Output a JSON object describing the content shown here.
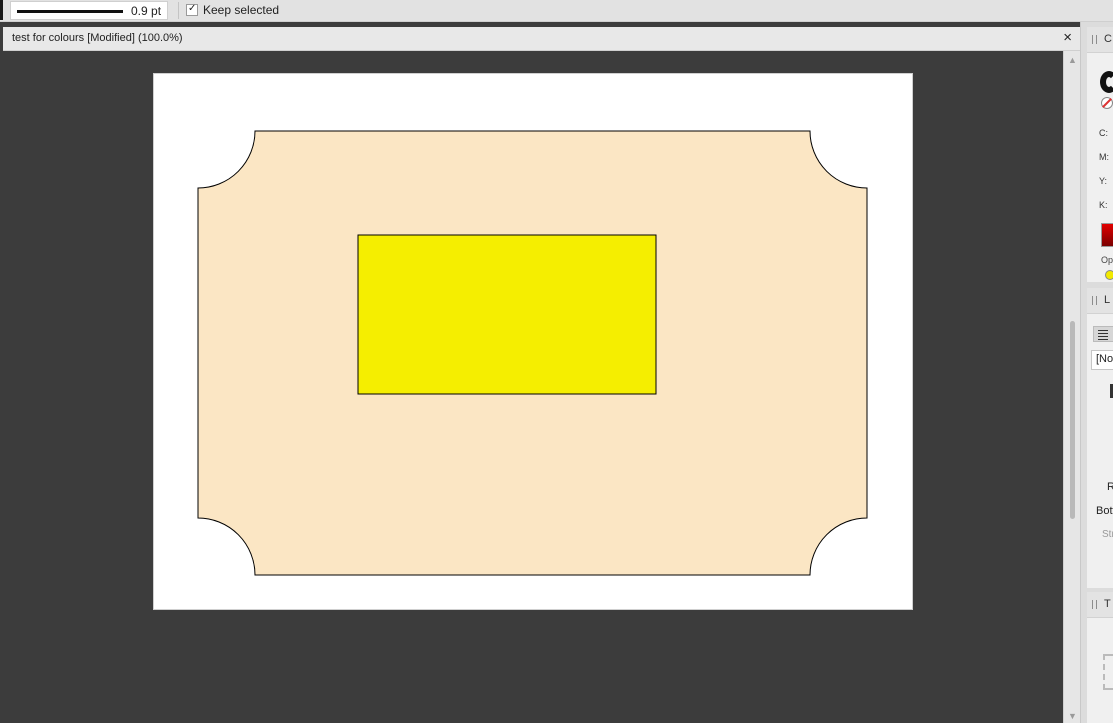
{
  "toolbar": {
    "stroke_width": "0.9 pt",
    "keep_selected_label": "Keep selected",
    "keep_selected_checked": true,
    "check_glyph": "✓"
  },
  "document_tab": {
    "title": "test for colours [Modified] (100.0%)",
    "close_glyph": "×"
  },
  "canvas": {
    "page_color": "#ffffff",
    "card_fill": "#fbe6c4",
    "rectangle_fill": "#f5ee00",
    "outline_color": "#000000"
  },
  "scrollbar": {
    "up_glyph": "▲",
    "down_glyph": "▼"
  },
  "panels": {
    "colour": {
      "title_letter": "C",
      "c_label": "C:",
      "m_label": "M:",
      "y_label": "Y:",
      "k_label": "K:",
      "opacity_label": "Op"
    },
    "layers": {
      "title_letter": "L",
      "style_field": "[No",
      "r_label": "R",
      "bottom_label": "Bott",
      "stroke_label": "Str"
    },
    "transform": {
      "title_letter": "T"
    }
  }
}
